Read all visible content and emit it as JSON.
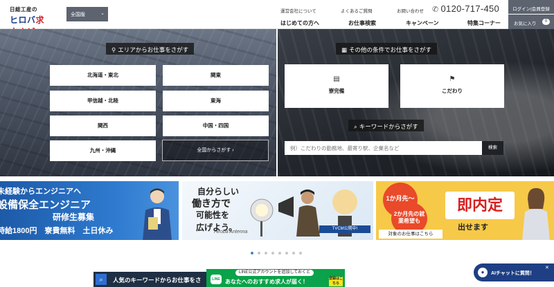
{
  "header": {
    "logo_top": "日総工産の",
    "logo_main_a": "ヒロバ",
    "logo_main_b": "求人ナビ",
    "region_label": "全国版",
    "util_links": [
      "運営会社について",
      "よくあるご質問",
      "お問い合わせ"
    ],
    "phone": "0120-717-450",
    "nav": [
      "はじめての方へ",
      "お仕事検索",
      "キャンペーン",
      "特集コーナー"
    ],
    "login_label": "ログイン|会員登録",
    "favorites_label": "お気に入り",
    "favorites_count": "0"
  },
  "area_search": {
    "title": "エリアからお仕事をさがす",
    "areas": [
      "北海道・東北",
      "関東",
      "甲信越・北陸",
      "東海",
      "関西",
      "中国・四国",
      "九州・沖縄"
    ],
    "all_label": "全国からさがす ›"
  },
  "condition_search": {
    "title": "その他の条件でお仕事をさがす",
    "options": [
      "寮完備",
      "こだわり"
    ],
    "keyword_title": "キーワードからさがす",
    "keyword_placeholder": "例）こだわりの勤務地、最寄り駅、企業名など",
    "keyword_button": "検索"
  },
  "banners": {
    "b1": {
      "line1": "未経験からエンジニアへ",
      "line2": "設備保全エンジニア",
      "line3": "研修生募集",
      "line4": "時給1800円　寮費無料　土日休み"
    },
    "b2": {
      "line1": "自分らしい",
      "line2": "働き方で",
      "line3": "可能性を",
      "line4": "広げよう。",
      "signature": "Hiroba Antenna",
      "tag": "TVCM公開中!"
    },
    "b3": {
      "circle1": "1か月先〜",
      "circle2": "2か月先の就業希望も",
      "big": "即内定",
      "sub": "出せます",
      "footer": "対象のお仕事はこちら"
    }
  },
  "carousel": {
    "count": 8,
    "active_index": 0
  },
  "bottom": {
    "keyword_bar_label": "人気のキーワードからお仕事をさ",
    "line_top": "LINE公式アカウントを追加しておくと",
    "line_main": "あなたへのおすすめ求人が届く！",
    "line_logo": "LINE",
    "line_badge": "登録はこちら",
    "ai_chat": "AIチャットに質問！"
  }
}
